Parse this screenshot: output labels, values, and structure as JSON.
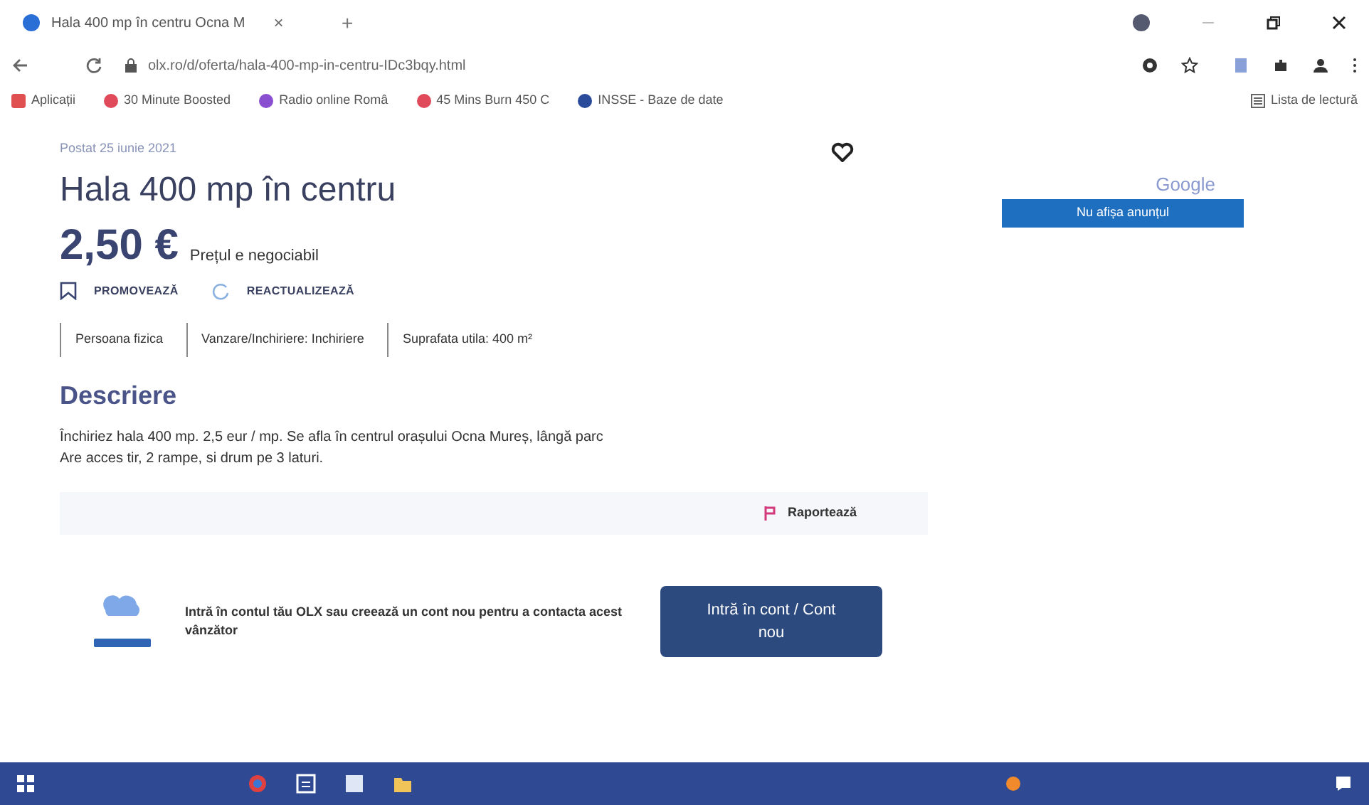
{
  "tab": {
    "title": "Hala 400 mp în centru Ocna M",
    "close": "×",
    "new_tab": "+"
  },
  "address_bar": {
    "url": "olx.ro/d/oferta/hala-400-mp-in-centru-IDc3bqy.html"
  },
  "bookmarks": [
    {
      "label": "Aplicații",
      "color": "#e05050"
    },
    {
      "label": "30 Minute Boosted",
      "color": "#e04a5a"
    },
    {
      "label": "Radio online Româ",
      "color": "#8a4fd0"
    },
    {
      "label": "45 Mins Burn 450 C",
      "color": "#e04a5a"
    },
    {
      "label": "INSSE - Baze de date",
      "color": "#2a4a9a"
    }
  ],
  "reading_list": "Lista de lectură",
  "listing": {
    "posted": "Postat 25 iunie 2021",
    "title": "Hala 400 mp în centru",
    "price": "2,50 €",
    "negotiable": "Prețul e negociabil",
    "actions": [
      "PROMOVEAZĂ",
      "REACTUALIZEAZĂ"
    ],
    "tags": [
      "Persoana fizica",
      "Vanzare/Inchiriere: Inchiriere",
      "Suprafata utila: 400 m²"
    ],
    "description_heading": "Descriere",
    "description": [
      "Închiriez hala 400 mp. 2,5 eur / mp. Se afla în centrul orașului Ocna Mureș, lângă parc",
      "Are acces tir, 2 rampe, si drum pe 3 laturi."
    ],
    "report": "Raportează"
  },
  "ad": {
    "brand": "Google",
    "button": "Nu afișa anunțul"
  },
  "login_prompt": {
    "text": "Intră în contul tău OLX sau creează un cont nou pentru a contacta acest vânzător",
    "button": "Intră în cont / Cont nou"
  }
}
